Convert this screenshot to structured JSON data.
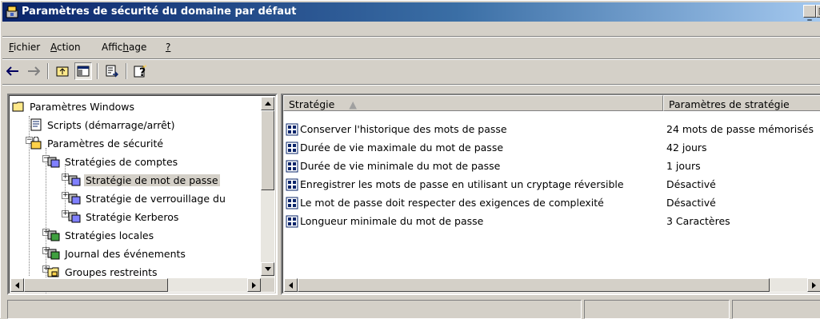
{
  "window": {
    "title": "Paramètres de sécurité du domaine par défaut"
  },
  "menu": [
    {
      "pre": "",
      "u": "F",
      "post": "ichier"
    },
    {
      "pre": "",
      "u": "A",
      "post": "ction"
    },
    {
      "pre": "Affic",
      "u": "h",
      "post": "age"
    },
    {
      "pre": "",
      "u": "?",
      "post": ""
    }
  ],
  "toolbar_icons": [
    "back-arrow-icon",
    "forward-arrow-icon",
    "up-folder-icon",
    "show-hide-tree-icon",
    "export-list-icon",
    "help-icon"
  ],
  "tree": {
    "items": [
      {
        "label": "Paramètres Windows"
      },
      {
        "label": "Scripts (démarrage/arrêt)"
      },
      {
        "label": "Paramètres de sécurité"
      },
      {
        "label": "Stratégies de comptes"
      },
      {
        "label": "Stratégie de mot de passe"
      },
      {
        "label": "Stratégie de verrouillage du"
      },
      {
        "label": "Stratégie Kerberos"
      },
      {
        "label": "Stratégies locales"
      },
      {
        "label": "Journal des événements"
      },
      {
        "label": "Groupes restreints"
      }
    ]
  },
  "list": {
    "col_policy": "Stratégie",
    "col_setting": "Paramètres de stratégie",
    "rows": [
      {
        "policy": "Conserver l'historique des mots de passe",
        "setting": "24 mots de passe mémorisés"
      },
      {
        "policy": "Durée de vie maximale du mot de passe",
        "setting": "42 jours"
      },
      {
        "policy": "Durée de vie minimale du mot de passe",
        "setting": "1 jours"
      },
      {
        "policy": "Enregistrer les mots de passe en utilisant un cryptage réversible",
        "setting": "Désactivé"
      },
      {
        "policy": "Le mot de passe doit respecter des exigences de complexité",
        "setting": "Désactivé"
      },
      {
        "policy": "Longueur minimale du mot de passe",
        "setting": "3 Caractères"
      }
    ]
  },
  "colors": {
    "title_start": "#0a246a",
    "title_end": "#a6caf0",
    "face": "#d4d0c8"
  }
}
